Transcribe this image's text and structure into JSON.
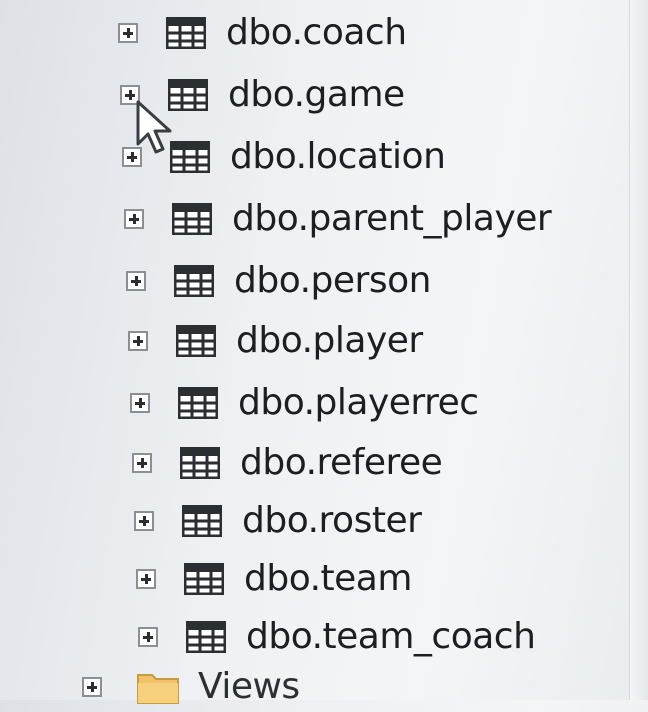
{
  "tree": {
    "items": [
      {
        "label": "dbo.coach",
        "icon": "table-icon"
      },
      {
        "label": "dbo.game",
        "icon": "table-icon"
      },
      {
        "label": "dbo.location",
        "icon": "table-icon"
      },
      {
        "label": "dbo.parent_player",
        "icon": "table-icon"
      },
      {
        "label": "dbo.person",
        "icon": "table-icon"
      },
      {
        "label": "dbo.player",
        "icon": "table-icon"
      },
      {
        "label": "dbo.playerrec",
        "icon": "table-icon"
      },
      {
        "label": "dbo.referee",
        "icon": "table-icon"
      },
      {
        "label": "dbo.roster",
        "icon": "table-icon"
      },
      {
        "label": "dbo.team",
        "icon": "table-icon"
      },
      {
        "label": "dbo.team_coach",
        "icon": "table-icon"
      }
    ],
    "folder": {
      "label": "Views",
      "icon": "folder-icon"
    }
  }
}
